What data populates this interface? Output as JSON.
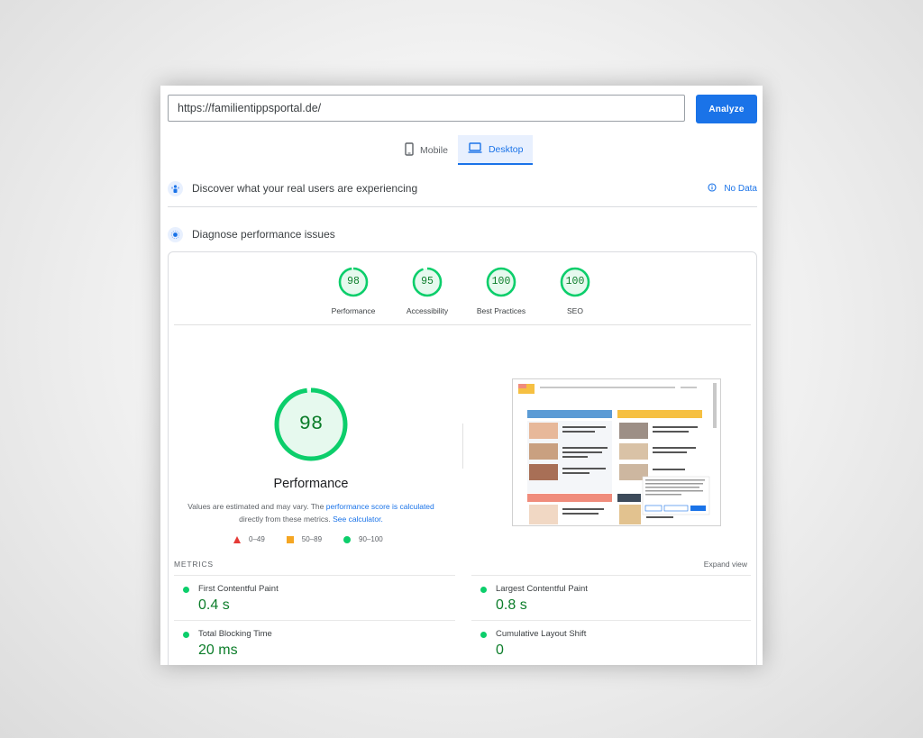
{
  "url_input": {
    "value": "https://familientippsportal.de/"
  },
  "analyze_label": "Analyze",
  "tabs": [
    {
      "label": "Mobile",
      "active": false
    },
    {
      "label": "Desktop",
      "active": true
    }
  ],
  "field_data": {
    "title": "Discover what your real users are experiencing",
    "no_data_label": "No Data"
  },
  "lab": {
    "title": "Diagnose performance issues"
  },
  "scores": [
    {
      "value": 98,
      "label": "Performance"
    },
    {
      "value": 95,
      "label": "Accessibility"
    },
    {
      "value": 100,
      "label": "Best Practices"
    },
    {
      "value": 100,
      "label": "SEO"
    }
  ],
  "performance": {
    "score": 98,
    "title": "Performance",
    "desc_part1": "Values are estimated and may vary. The",
    "desc_link1": "performance score is calculated",
    "desc_part2": "directly from these metrics.",
    "desc_link2": "See calculator."
  },
  "legend": [
    {
      "range": "0–49"
    },
    {
      "range": "50–89"
    },
    {
      "range": "90–100"
    }
  ],
  "metrics_label": "METRICS",
  "expand_label": "Expand view",
  "metrics": [
    {
      "name": "First Contentful Paint",
      "value": "0.4 s"
    },
    {
      "name": "Largest Contentful Paint",
      "value": "0.8 s"
    },
    {
      "name": "Total Blocking Time",
      "value": "20 ms"
    },
    {
      "name": "Cumulative Layout Shift",
      "value": "0"
    }
  ],
  "screenshot": {
    "left_header": "Eltern und Erziehung",
    "right_header": "Schwangerschaft und Geburt",
    "left_items": [
      "Babyphonesystem im Kinder-Alltag",
      "Gesellschaftsspiel bei Kindern: Wie Eltern die Spielerfahrung positiv fördern",
      "Schlafen mit Kindern: gesundheitliche Aspekte für Eltern"
    ],
    "right_items": [
      "Frühchenfürsorge: Wie sich Eltern vorbereiten können",
      "Stillen lernen: Tipps für junge Mütter nach der Geburt",
      "Was werdende Eltern wissen müssen"
    ],
    "bottom_left_header": "Kinder und Familie",
    "bottom_left_item": "Checkliste für Babys: Tipps gegen Schlafprobleme",
    "bottom_right_header": "Aktuelles",
    "colors": {
      "blue": "#5b9bd5",
      "yellow": "#f6c042",
      "coral": "#f08c7c",
      "dark": "#3c4a5a",
      "accent": "#1a73e8"
    }
  },
  "colors": {
    "pass": "#0cce6b",
    "pass_text": "#0c7d2a",
    "average": "#f5a623",
    "fail": "#e53935",
    "accent": "#1a73e8"
  }
}
